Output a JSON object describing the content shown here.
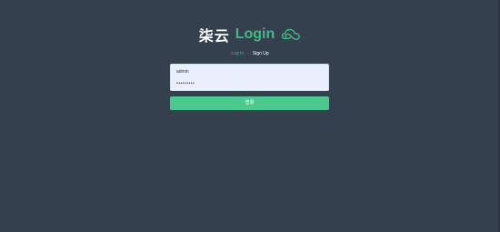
{
  "brand": {
    "chinese_text": "柒云",
    "title": "Login",
    "icon": "cloud-icon",
    "accent_color": "#42b983"
  },
  "auth_switch": {
    "login_label": "Log In",
    "separator": "·",
    "signup_label": "Sign Up"
  },
  "form": {
    "username_value": "admin",
    "password_mask": "•••••••••",
    "submit_label": "登录"
  },
  "colors": {
    "background": "#35404f",
    "input_background": "#e8f0fe",
    "button": "#4cc98f"
  }
}
